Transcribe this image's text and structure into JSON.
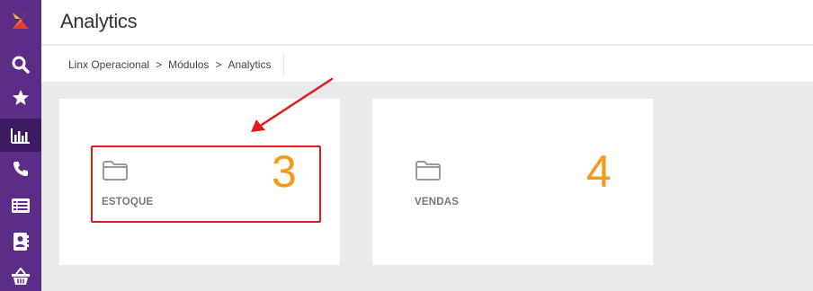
{
  "app": {
    "title": "Analytics"
  },
  "breadcrumb": {
    "items": [
      "Linx Operacional",
      "Módulos",
      "Analytics"
    ],
    "separator": ">"
  },
  "sidebar": {
    "items": [
      {
        "name": "search",
        "icon": "search-icon"
      },
      {
        "name": "favorites",
        "icon": "star-icon"
      },
      {
        "name": "analytics",
        "icon": "bar-chart-icon",
        "active": true
      },
      {
        "name": "phone",
        "icon": "phone-icon"
      },
      {
        "name": "list",
        "icon": "list-icon"
      },
      {
        "name": "contacts",
        "icon": "contact-book-icon"
      },
      {
        "name": "store",
        "icon": "basket-icon"
      }
    ]
  },
  "cards": [
    {
      "label": "ESTOQUE",
      "count": "3",
      "icon": "folder-icon"
    },
    {
      "label": "VENDAS",
      "count": "4",
      "icon": "folder-icon"
    }
  ],
  "colors": {
    "sidebar": "#5b2d86",
    "sidebar_active": "#3e1a62",
    "count": "#f49a1a",
    "annotation": "#e11b1b"
  }
}
